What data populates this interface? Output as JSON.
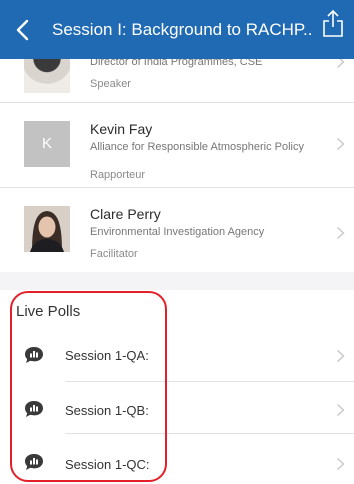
{
  "navbar": {
    "title": "Session I: Background to RACHP...",
    "colors": {
      "background": "#1f6ab3",
      "text": "#ffffff"
    }
  },
  "speakers": [
    {
      "name": "",
      "organization": "Director of India Programmes, CSE",
      "role": "Speaker"
    },
    {
      "name": "Kevin Fay",
      "initial": "K",
      "organization": "Alliance for Responsible Atmospheric Policy",
      "role": "Rapporteur"
    },
    {
      "name": "Clare Perry",
      "organization": "Environmental Investigation Agency",
      "role": "Facilitator"
    }
  ],
  "live_polls": {
    "heading": "Live Polls",
    "items": [
      {
        "label": "Session 1-QA:"
      },
      {
        "label": "Session 1-QB:"
      },
      {
        "label": "Session 1-QC:"
      }
    ]
  },
  "annotation_color": "#e3202a"
}
